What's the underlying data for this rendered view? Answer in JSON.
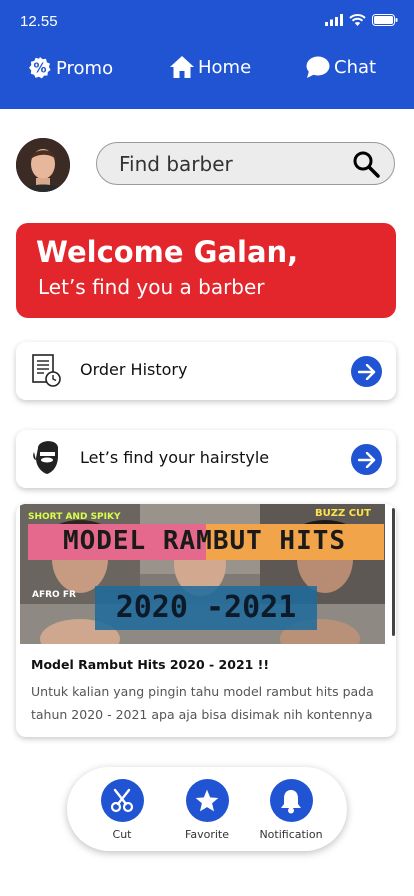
{
  "status_bar": {
    "time": "12.55"
  },
  "top_nav": {
    "promo": "Promo",
    "home": "Home",
    "chat": "Chat"
  },
  "search": {
    "placeholder": "Find barber"
  },
  "welcome": {
    "title": "Welcome Galan,",
    "subtitle": "Let’s find you a barber"
  },
  "cards": {
    "order_history": "Order History",
    "hairstyle": "Let’s find your hairstyle"
  },
  "article": {
    "image_banner": "MODEL RAMBUT HITS",
    "image_years": "2020 -2021",
    "image_tag_left": "SHORT AND SPIKY",
    "image_tag_right": "BUZZ CUT",
    "image_tag_afro": "AFRO FR",
    "title": "Model Rambut Hits 2020 - 2021 !!",
    "description": "Untuk kalian yang pingin tahu model rambut hits pada tahun 2020 - 2021 apa aja bisa disimak nih kontennya"
  },
  "bottom_nav": {
    "cut": "Cut",
    "favorite": "Favorite",
    "notification": "Notification"
  },
  "colors": {
    "primary": "#2154d3",
    "welcome_red": "#e3262c"
  }
}
